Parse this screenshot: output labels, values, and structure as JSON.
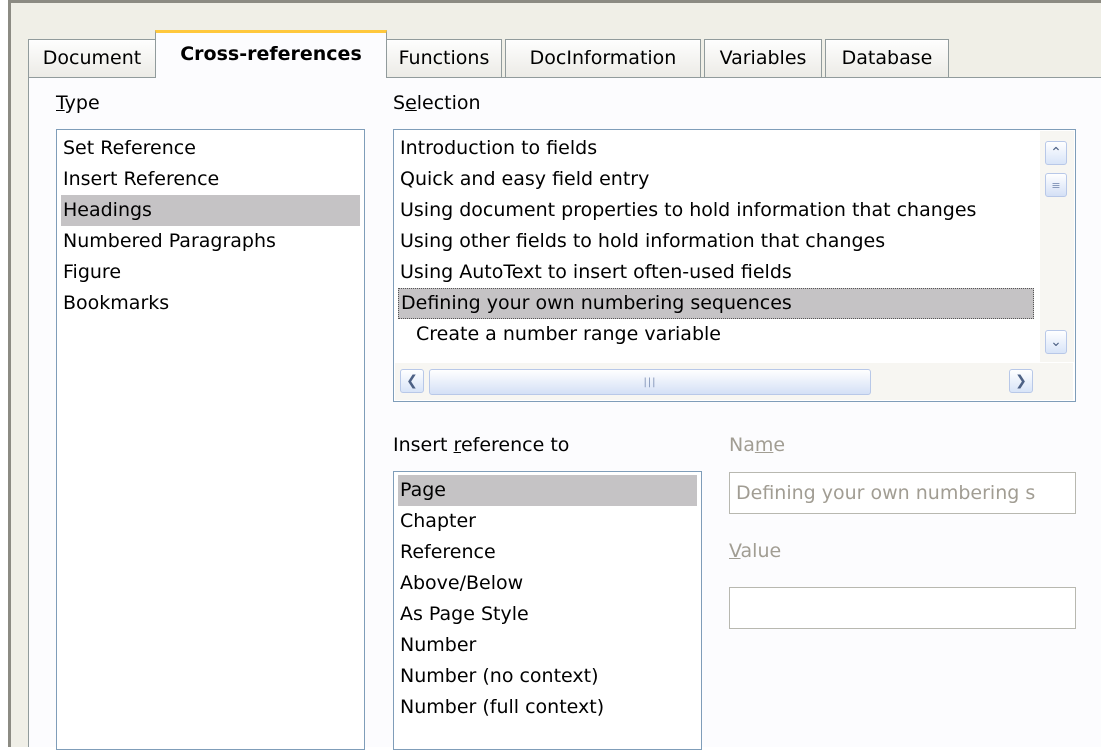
{
  "tabs": [
    "Document",
    "Cross-references",
    "Functions",
    "DocInformation",
    "Variables",
    "Database"
  ],
  "active_tab": "Cross-references",
  "type": {
    "label_pre": "",
    "label_mnemonic": "T",
    "label_post": "ype",
    "items": [
      "Set Reference",
      "Insert Reference",
      "Headings",
      "Numbered Paragraphs",
      "Figure",
      "Bookmarks"
    ],
    "selected": "Headings"
  },
  "selection": {
    "label_pre": "S",
    "label_mnemonic": "e",
    "label_post": "lection",
    "items": [
      "Introduction to fields",
      "Quick and easy field entry",
      "Using document properties to hold information that changes",
      "Using other fields to hold information that changes",
      "Using AutoText to insert often-used fields",
      "Defining your own numbering sequences",
      "Create a number range variable"
    ],
    "selected": "Defining your own numbering sequences",
    "scroll_up_icon": "chevron-up-icon",
    "scroll_down_icon": "chevron-down-icon",
    "scroll_left_icon": "chevron-left-icon",
    "scroll_right_icon": "chevron-right-icon"
  },
  "insert_reference": {
    "label_pre": "Insert ",
    "label_mnemonic": "r",
    "label_post": "eference to",
    "items": [
      "Page",
      "Chapter",
      "Reference",
      "Above/Below",
      "As Page Style",
      "Number",
      "Number (no context)",
      "Number (full context)"
    ],
    "selected": "Page"
  },
  "name": {
    "label_pre": "Na",
    "label_mnemonic": "m",
    "label_post": "e",
    "value": "Defining your own numbering s"
  },
  "value_field": {
    "label_pre": "",
    "label_mnemonic": "V",
    "label_post": "alue",
    "value": ""
  }
}
